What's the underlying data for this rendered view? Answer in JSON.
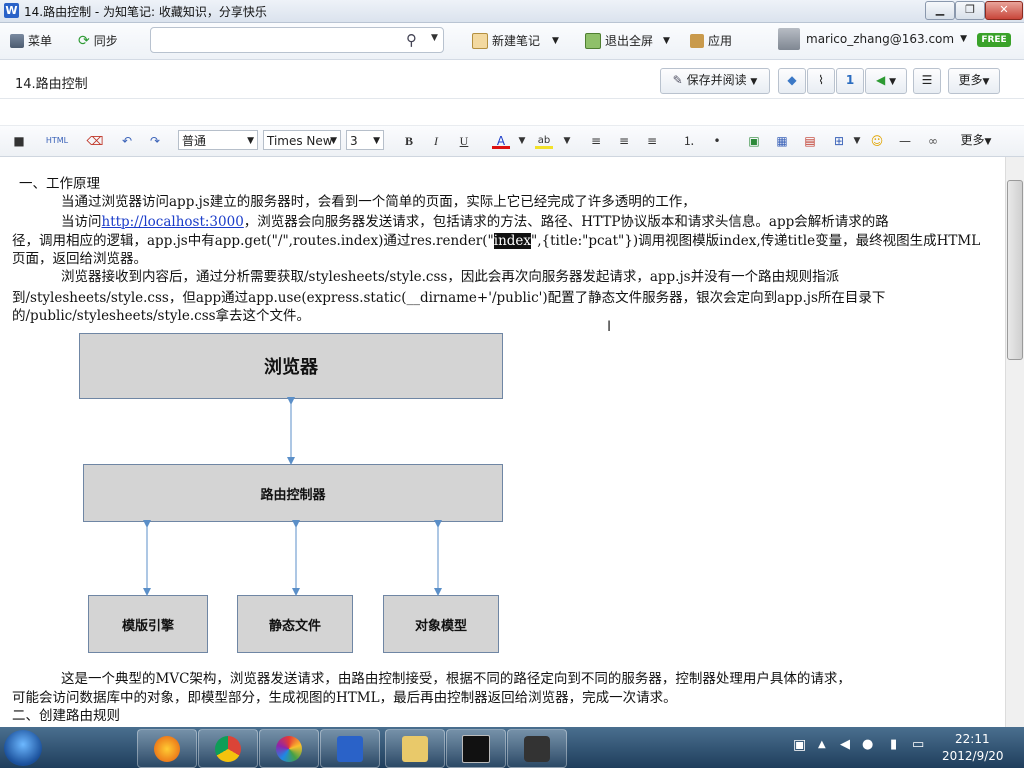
{
  "window": {
    "title": "14.路由控制 - 为知笔记: 收藏知识，分享快乐",
    "app_icon_letter": "W"
  },
  "window_controls": {
    "minimize": "▁",
    "maximize": "❐",
    "close": "✕"
  },
  "toolbar": {
    "menu": "菜单",
    "sync": "同步",
    "new_note": "新建笔记",
    "exit_fullscreen": "退出全屏",
    "apps": "应用",
    "account": "marico_zhang@163.com",
    "free_badge": "FREE"
  },
  "note": {
    "title": "14.路由控制",
    "save_read": "保存并阅读",
    "more": "更多",
    "info": "1"
  },
  "format": {
    "style": "普通",
    "font": "Times New",
    "size": "3",
    "more": "更多",
    "bold": "B",
    "italic": "I",
    "underline": "U",
    "html": "HTML"
  },
  "doc": {
    "h1": "一、工作原理",
    "p1": "当通过浏览器访问app.js建立的服务器时，会看到一个简单的页面，实际上它已经完成了许多透明的工作，",
    "p2_a": "当访问",
    "p2_link": "http://localhost:3000",
    "p2_b": "，浏览器会向服务器发送请求，包括请求的方法、路径、HTTP协议版本和请求头信息。app会解析请求的路",
    "p2_c1": "径，调用相应的逻辑，app.js中有app.get(\"/\",routes.index)通过res.render(\"",
    "p2_sel": "index",
    "p2_c2": "\",{title:\"pcat\"})调用视图模版index,传递title变量，最终视图生成HTML",
    "p2_d": "页面，返回给浏览器。",
    "p3_a": "浏览器接收到内容后，通过分析需要获取/stylesheets/style.css，因此会再次向服务器发起请求，app.js并没有一个路由规则指派",
    "p3_b": "到/stylesheets/style.css，但app通过app.use(express.static(__dirname+'/public')配置了静态文件服务器，银次会定向到app.js所在目录下",
    "p3_c": "的/public/stylesheets/style.css拿去这个文件。",
    "p4_a": "这是一个典型的MVC架构，浏览器发送请求，由路由控制接受，根据不同的路径定向到不同的服务器，控制器处理用户具体的请求，",
    "p4_b": "可能会访问数据库中的对象，即模型部分，生成视图的HTML，最后再由控制器返回给浏览器，完成一次请求。",
    "h2": "二、创建路由规则"
  },
  "diagram": {
    "browser": "浏览器",
    "router": "路由控制器",
    "engine": "模版引擎",
    "static": "静态文件",
    "model": "对象模型"
  },
  "taskbar": {
    "time": "22:11",
    "date": "2012/9/20"
  }
}
